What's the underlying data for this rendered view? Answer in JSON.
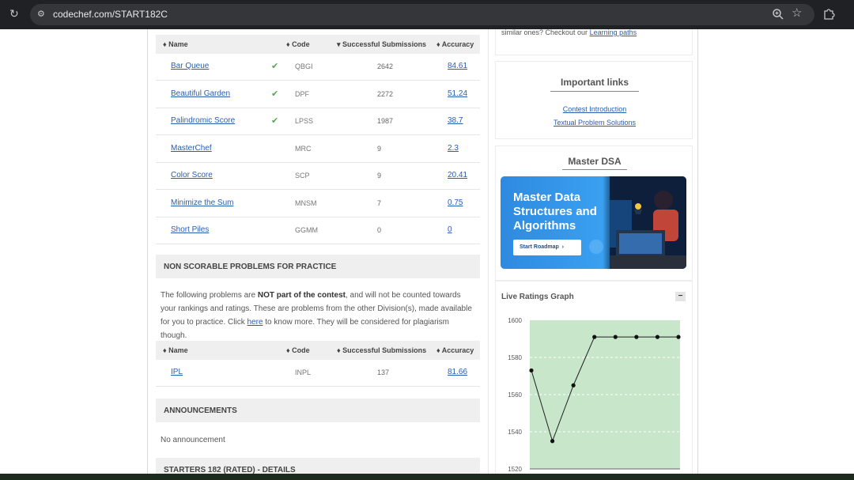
{
  "browser": {
    "url": "codechef.com/START182C",
    "reload_icon": "reload-icon",
    "site_icon": "site-settings-icon"
  },
  "scorable_table": {
    "headers": {
      "name": "Name",
      "code": "Code",
      "subs": "Successful Submissions",
      "acc": "Accuracy"
    },
    "rows": [
      {
        "name": "Bar Queue",
        "solved": true,
        "code": "QBGI",
        "subs": "2642",
        "acc": "84.61"
      },
      {
        "name": "Beautiful Garden",
        "solved": true,
        "code": "DPF",
        "subs": "2272",
        "acc": "51.24"
      },
      {
        "name": "Palindromic Score",
        "solved": true,
        "code": "LPSS",
        "subs": "1987",
        "acc": "38.7"
      },
      {
        "name": "MasterChef",
        "solved": false,
        "code": "MRC",
        "subs": "9",
        "acc": "2.3"
      },
      {
        "name": "Color Score",
        "solved": false,
        "code": "SCP",
        "subs": "9",
        "acc": "20.41"
      },
      {
        "name": "Minimize the Sum",
        "solved": false,
        "code": "MNSM",
        "subs": "7",
        "acc": "0.75"
      },
      {
        "name": "Short Piles",
        "solved": false,
        "code": "GGMM",
        "subs": "0",
        "acc": "0"
      }
    ]
  },
  "non_scorable": {
    "title": "NON SCORABLE PROBLEMS FOR PRACTICE",
    "para_1": "The following problems are ",
    "para_bold": "NOT part of the contest",
    "para_2": ", and will not be counted towards your rankings and ratings. These are problems from the other Division(s), made available for you to practice. Click ",
    "para_link": "here",
    "para_3": " to know more. They will be considered for plagiarism though.",
    "headers": {
      "name": "Name",
      "code": "Code",
      "subs": "Successful Submissions",
      "acc": "Accuracy"
    },
    "rows": [
      {
        "name": "IPL",
        "code": "INPL",
        "subs": "137",
        "acc": "81.66"
      }
    ]
  },
  "announcements": {
    "title": "ANNOUNCEMENTS",
    "text": "No announcement"
  },
  "details": {
    "title": "STARTERS 182 (RATED) - DETAILS"
  },
  "sidebar": {
    "top_text": "similar ones? Checkout our ",
    "top_link": "Learning paths",
    "important_links": {
      "title": "Important links",
      "links": [
        "Contest Introduction",
        "Textual Problem Solutions"
      ]
    },
    "master_dsa": {
      "title": "Master DSA",
      "banner_title": "Master Data Structures and Algorithms",
      "banner_button": "Start Roadmap"
    },
    "ratings_graph": {
      "title": "Live Ratings Graph",
      "collapse_label": "−"
    }
  },
  "colors": {
    "link": "#2a5db0",
    "check": "#52a852",
    "graph_fill": "#c8e6c9"
  },
  "chart_data": {
    "type": "line",
    "title": "",
    "xlabel": "",
    "ylabel": "",
    "ylim": [
      1520,
      1600
    ],
    "yticks": [
      1520,
      1540,
      1560,
      1580,
      1600
    ],
    "values": [
      1573,
      1535,
      1565,
      1591,
      1591,
      1591,
      1591,
      1591
    ]
  }
}
